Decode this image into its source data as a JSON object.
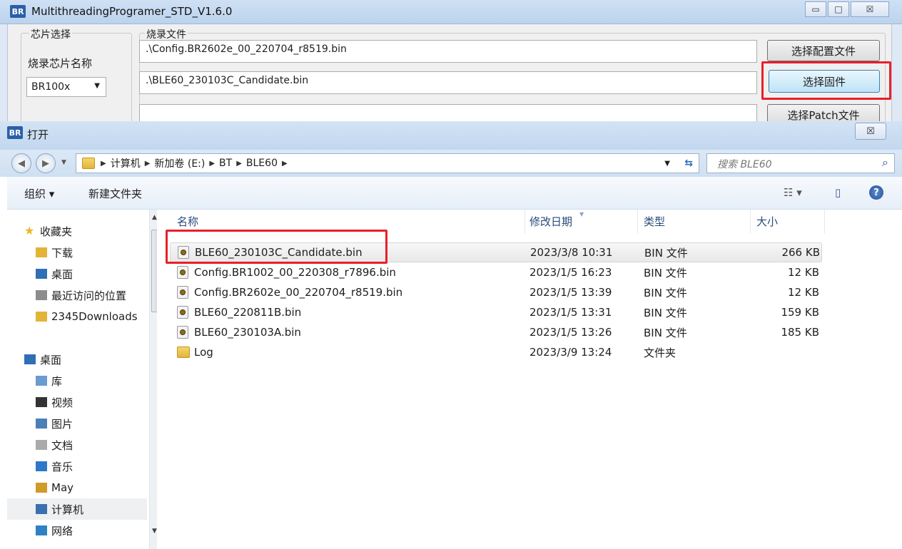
{
  "main_window": {
    "title": "MultithreadingProgramer_STD_V1.6.0",
    "logo": "BR",
    "window_buttons": {
      "minimize": "▭",
      "restore": "□",
      "close": "☒"
    },
    "chip_group": {
      "label": "芯片选择",
      "chip_name_label": "烧录芯片名称",
      "chip_value": "BR100x"
    },
    "burn_group": {
      "label": "烧录文件",
      "config_path": ".\\Config.BR2602e_00_220704_r8519.bin",
      "firmware_path": ".\\BLE60_230103C_Candidate.bin",
      "patch_path": ""
    },
    "buttons": {
      "select_config": "选择配置文件",
      "select_firmware": "选择固件",
      "select_patch": "选择Patch文件"
    }
  },
  "dialog": {
    "title": "打开",
    "logo": "BR",
    "close_glyph": "☒",
    "breadcrumb": [
      "计算机",
      "新加卷 (E:)",
      "BT",
      "BLE60"
    ],
    "search_placeholder": "搜索 BLE60",
    "toolbar": {
      "organize": "组织 ▾",
      "new_folder": "新建文件夹",
      "views_glyph": "☷ ▾",
      "pane_glyph": "▯",
      "help_glyph": "?"
    },
    "nav_items": [
      {
        "label": "收藏夹",
        "icon": "star-icon",
        "indent": false
      },
      {
        "label": "下载",
        "icon": "download-folder-icon",
        "indent": true
      },
      {
        "label": "桌面",
        "icon": "desktop-icon",
        "indent": true
      },
      {
        "label": "最近访问的位置",
        "icon": "recent-places-icon",
        "indent": true
      },
      {
        "label": "2345Downloads",
        "icon": "folder-icon",
        "indent": true
      },
      {
        "label": "",
        "icon": "",
        "indent": false
      },
      {
        "label": "桌面",
        "icon": "desktop-icon",
        "indent": false
      },
      {
        "label": "库",
        "icon": "library-icon",
        "indent": true
      },
      {
        "label": "视频",
        "icon": "video-icon",
        "indent": true
      },
      {
        "label": "图片",
        "icon": "picture-icon",
        "indent": true
      },
      {
        "label": "文档",
        "icon": "document-icon",
        "indent": true
      },
      {
        "label": "音乐",
        "icon": "music-icon",
        "indent": true
      },
      {
        "label": "May",
        "icon": "user-folder-icon",
        "indent": true
      },
      {
        "label": "计算机",
        "icon": "computer-icon",
        "indent": true
      },
      {
        "label": "网络",
        "icon": "network-icon",
        "indent": true
      }
    ],
    "columns": {
      "name": "名称",
      "date": "修改日期",
      "type": "类型",
      "size": "大小"
    },
    "files": [
      {
        "name": "BLE60_230103C_Candidate.bin",
        "date": "2023/3/8 10:31",
        "type": "BIN 文件",
        "size": "266 KB",
        "kind": "bin"
      },
      {
        "name": "Config.BR1002_00_220308_r7896.bin",
        "date": "2023/1/5 16:23",
        "type": "BIN 文件",
        "size": "12 KB",
        "kind": "bin"
      },
      {
        "name": "Config.BR2602e_00_220704_r8519.bin",
        "date": "2023/1/5 13:39",
        "type": "BIN 文件",
        "size": "12 KB",
        "kind": "bin"
      },
      {
        "name": "BLE60_220811B.bin",
        "date": "2023/1/5 13:31",
        "type": "BIN 文件",
        "size": "159 KB",
        "kind": "bin"
      },
      {
        "name": "BLE60_230103A.bin",
        "date": "2023/1/5 13:26",
        "type": "BIN 文件",
        "size": "185 KB",
        "kind": "bin"
      },
      {
        "name": "Log",
        "date": "2023/3/9 13:24",
        "type": "文件夹",
        "size": "",
        "kind": "folder"
      }
    ]
  }
}
